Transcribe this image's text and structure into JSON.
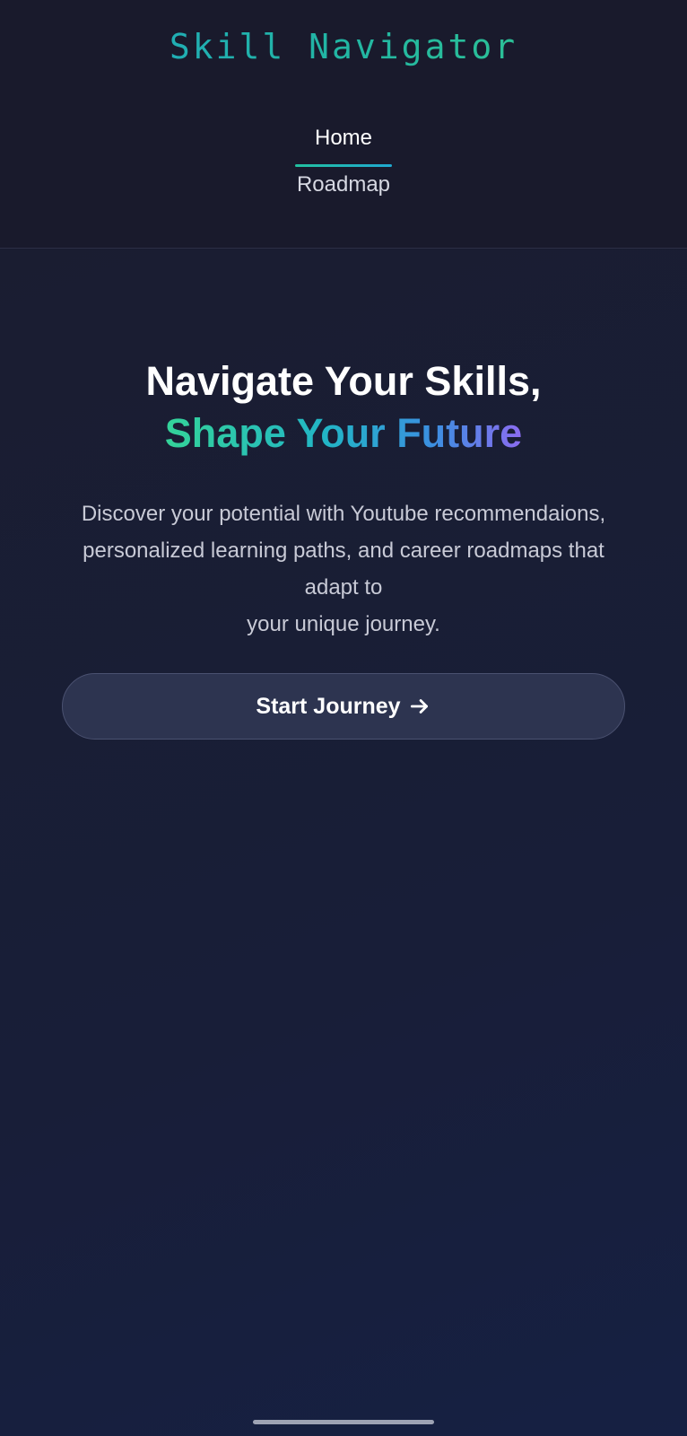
{
  "header": {
    "logo": "Skill Navigator",
    "nav": {
      "home_label": "Home",
      "roadmap_label": "Roadmap"
    }
  },
  "hero": {
    "title_line1": "Navigate Your Skills,",
    "title_line2": "Shape Your Future",
    "description_lines": [
      "Discover your potential with Youtube recommendaions,",
      "personalized learning paths, and career roadmaps that",
      "adapt to",
      "your unique journey."
    ],
    "cta_label": "Start Journey"
  },
  "icons": {
    "cta_icon": "arrow-right-icon"
  },
  "colors": {
    "background": "#181c30",
    "header_background": "#191a2c",
    "accent_teal": "#22b6a3",
    "accent_green": "#34d399",
    "accent_purple": "#8b6cf0",
    "button_background": "#2d3450"
  }
}
